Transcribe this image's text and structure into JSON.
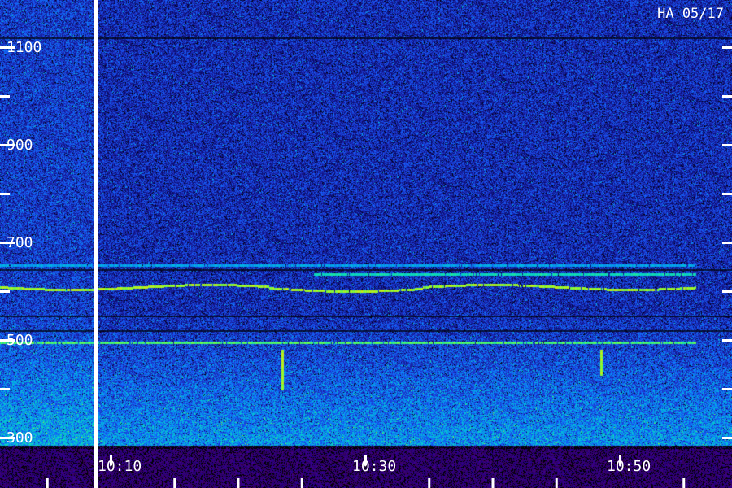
{
  "chart_data": {
    "type": "heatmap",
    "station": "HA 05/17",
    "y_ticks": [
      {
        "value": 300,
        "label": "300"
      },
      {
        "value": 500,
        "label": "500"
      },
      {
        "value": 700,
        "label": "700"
      },
      {
        "value": 900,
        "label": "900"
      },
      {
        "value": 1100,
        "label": "1100"
      }
    ],
    "y_minor_ticks": [
      400,
      600,
      800,
      1000,
      1200
    ],
    "ylim": [
      300,
      1200
    ],
    "x_ticks": [
      {
        "value": "10:10",
        "label": "10:10"
      },
      {
        "value": "10:30",
        "label": "10:30"
      },
      {
        "value": "10:50",
        "label": "10:50"
      }
    ],
    "xlim": [
      "10:10",
      "10:56"
    ],
    "marker_time": "10:09",
    "colormap": [
      "#000000",
      "#0b0b6e",
      "#1e2ab8",
      "#1560ff",
      "#00b4e6",
      "#10e0b0",
      "#7cff3a",
      "#ffe000"
    ],
    "bands": [
      {
        "freq": 610,
        "from": "10:00",
        "to": "10:56",
        "intensity": 0.95,
        "drift": true
      },
      {
        "freq": 497,
        "from": "10:00",
        "to": "10:56",
        "intensity": 0.85,
        "drift": false
      },
      {
        "freq": 655,
        "from": "10:00",
        "to": "10:56",
        "intensity": 0.6,
        "drift": false
      },
      {
        "freq": 636,
        "from": "10:26",
        "to": "10:56",
        "intensity": 0.75,
        "drift": false
      }
    ],
    "dark_lines": [
      {
        "freq": 1120
      },
      {
        "freq": 645
      },
      {
        "freq": 550
      },
      {
        "freq": 520
      }
    ]
  }
}
